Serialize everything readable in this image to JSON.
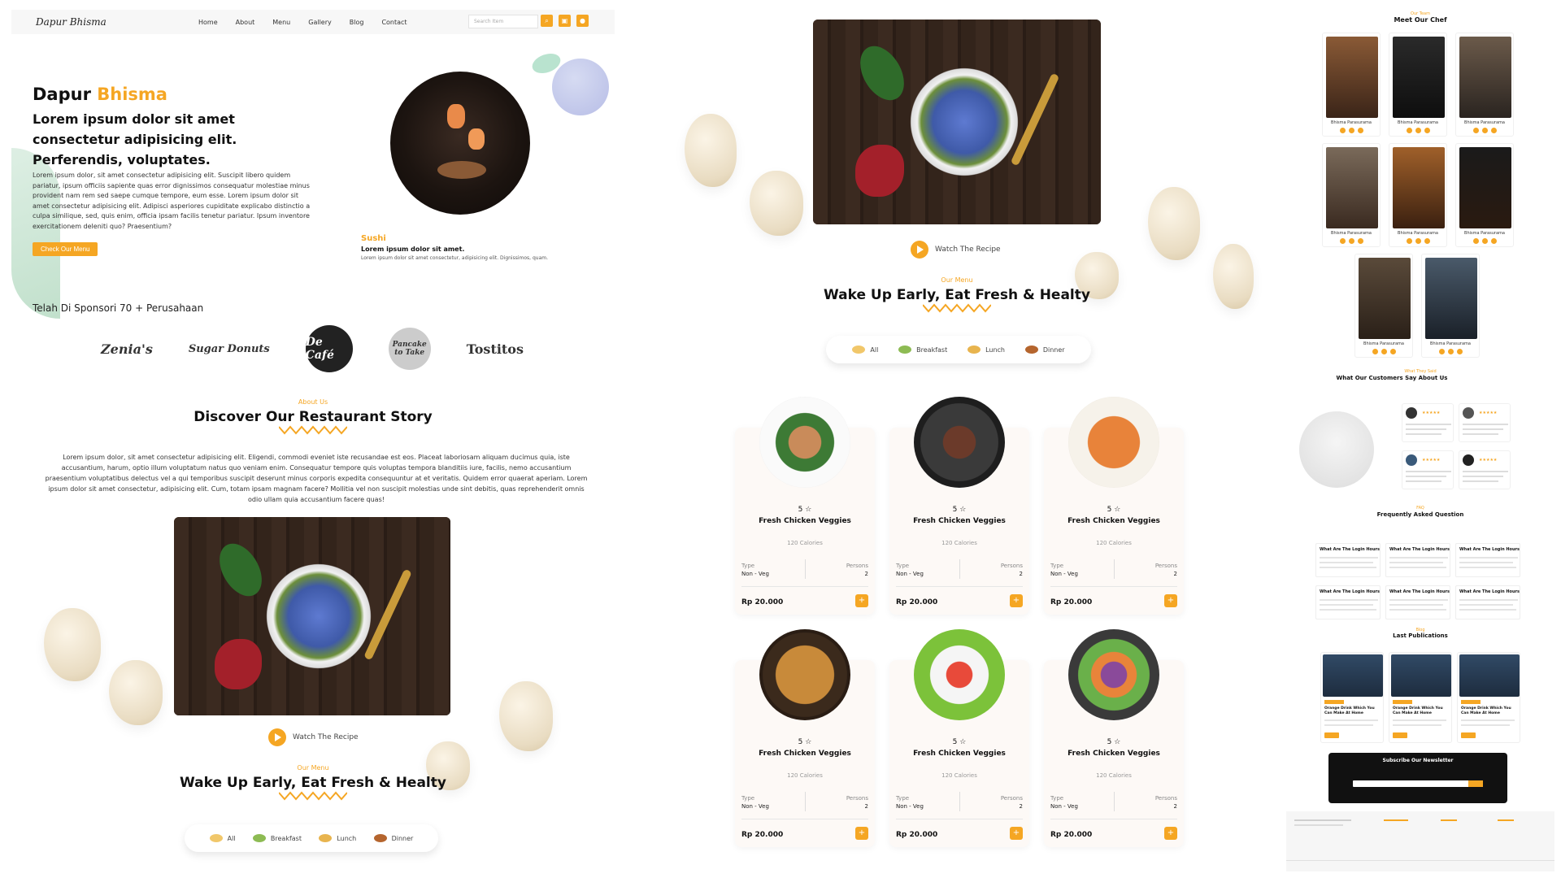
{
  "nav": {
    "logo": "Dapur Bhisma",
    "links": [
      "Home",
      "About",
      "Menu",
      "Gallery",
      "Blog",
      "Contact"
    ],
    "search_placeholder": "Search Item"
  },
  "hero": {
    "title_main": "Dapur ",
    "title_accent": "Bhisma",
    "subtitle": "Lorem ipsum dolor sit amet consectetur adipisicing elit. Perferendis, voluptates.",
    "paragraph": "Lorem ipsum dolor, sit amet consectetur adipisicing elit. Suscipit libero quidem pariatur, ipsum officiis sapiente quas error dignissimos consequatur molestiae minus provident nam rem sed saepe cumque tempore, eum esse. Lorem ipsum dolor sit amet consectetur adipisicing elit. Adipisci asperiores cupiditate explicabo distinctio a culpa similique, sed, quis enim, officia ipsam facilis tenetur pariatur. Ipsum inventore exercitationem deleniti quo? Praesentium?",
    "button": "Check Our Menu",
    "feature_label": "Sushi",
    "feature_title": "Lorem ipsum dolor sit amet.",
    "feature_text": "Lorem ipsum dolor sit amet consectetur, adipisicing elit. Dignissimos, quam."
  },
  "sponsors": {
    "heading": "Telah Di Sponsori 70 + Perusahaan",
    "brands": [
      "Zenia's",
      "Sugar Donuts",
      "De Café",
      "Pancake to Take",
      "Tostitos"
    ]
  },
  "about": {
    "label": "About Us",
    "title": "Discover Our Restaurant Story",
    "paragraph": "Lorem ipsum dolor, sit amet consectetur adipisicing elit. Eligendi, commodi eveniet iste recusandae est eos. Placeat laboriosam aliquam ducimus quia, iste accusantium, harum, optio illum voluptatum natus quo veniam enim. Consequatur tempore quis voluptas tempora blanditiis iure, facilis, nemo accusantium praesentium voluptatibus delectus vel a qui temporibus suscipit deserunt minus corporis expedita consequuntur at et veritatis. Quidem error quaerat aperiam. Lorem ipsum dolor sit amet consectetur, adipisicing elit. Cum, totam ipsam magnam facere? Mollitia vel non suscipit molestias unde sint debitis, quas reprehenderit omnis odio ullam quia accusantium facere quas!"
  },
  "watch_label": "Watch The Recipe",
  "menu": {
    "label": "Our Menu",
    "title": "Wake Up Early, Eat Fresh & Healty",
    "filters": [
      "All",
      "Breakfast",
      "Lunch",
      "Dinner"
    ],
    "cards": [
      {
        "rating": "5 ☆",
        "name": "Fresh Chicken Veggies",
        "calories": "120 Calories",
        "type_label": "Type",
        "type": "Non - Veg",
        "persons_label": "Persons",
        "persons": "2",
        "price": "Rp 20.000"
      },
      {
        "rating": "5 ☆",
        "name": "Fresh Chicken Veggies",
        "calories": "120 Calories",
        "type_label": "Type",
        "type": "Non - Veg",
        "persons_label": "Persons",
        "persons": "2",
        "price": "Rp 20.000"
      },
      {
        "rating": "5 ☆",
        "name": "Fresh Chicken Veggies",
        "calories": "120 Calories",
        "type_label": "Type",
        "type": "Non - Veg",
        "persons_label": "Persons",
        "persons": "2",
        "price": "Rp 20.000"
      },
      {
        "rating": "5 ☆",
        "name": "Fresh Chicken Veggies",
        "calories": "120 Calories",
        "type_label": "Type",
        "type": "Non - Veg",
        "persons_label": "Persons",
        "persons": "2",
        "price": "Rp 20.000"
      },
      {
        "rating": "5 ☆",
        "name": "Fresh Chicken Veggies",
        "calories": "120 Calories",
        "type_label": "Type",
        "type": "Non - Veg",
        "persons_label": "Persons",
        "persons": "2",
        "price": "Rp 20.000"
      },
      {
        "rating": "5 ☆",
        "name": "Fresh Chicken Veggies",
        "calories": "120 Calories",
        "type_label": "Type",
        "type": "Non - Veg",
        "persons_label": "Persons",
        "persons": "2",
        "price": "Rp 20.000"
      }
    ]
  },
  "chefs": {
    "label": "Our Team",
    "title": "Meet Our Chef",
    "names": [
      "Bhisma Parasurama",
      "Bhisma Parasurama",
      "Bhisma Parasurama",
      "Bhisma Parasurama",
      "Bhisma Parasurama",
      "Bhisma Parasurama",
      "Bhisma Parasurama",
      "Bhisma Parasurama"
    ]
  },
  "testimonials": {
    "label": "What They Said",
    "title": "What Our Customers Say About Us"
  },
  "faq": {
    "label": "FAQ",
    "title": "Frequently Asked Question",
    "questions": [
      "What Are The Login Hours",
      "What Are The Login Hours",
      "What Are The Login Hours",
      "What Are The Login Hours",
      "What Are The Login Hours",
      "What Are The Login Hours"
    ]
  },
  "publications": {
    "label": "Blog",
    "title": "Last Publications",
    "titles": [
      "Orange Drink Which You Can Make At Home",
      "Orange Drink Which You Can Make At Home",
      "Orange Drink Which You Can Make At Home"
    ]
  },
  "newsletter": {
    "title": "Subscribe Our Newsletter"
  },
  "colors": {
    "accent": "#f5a623",
    "text": "#111111"
  }
}
